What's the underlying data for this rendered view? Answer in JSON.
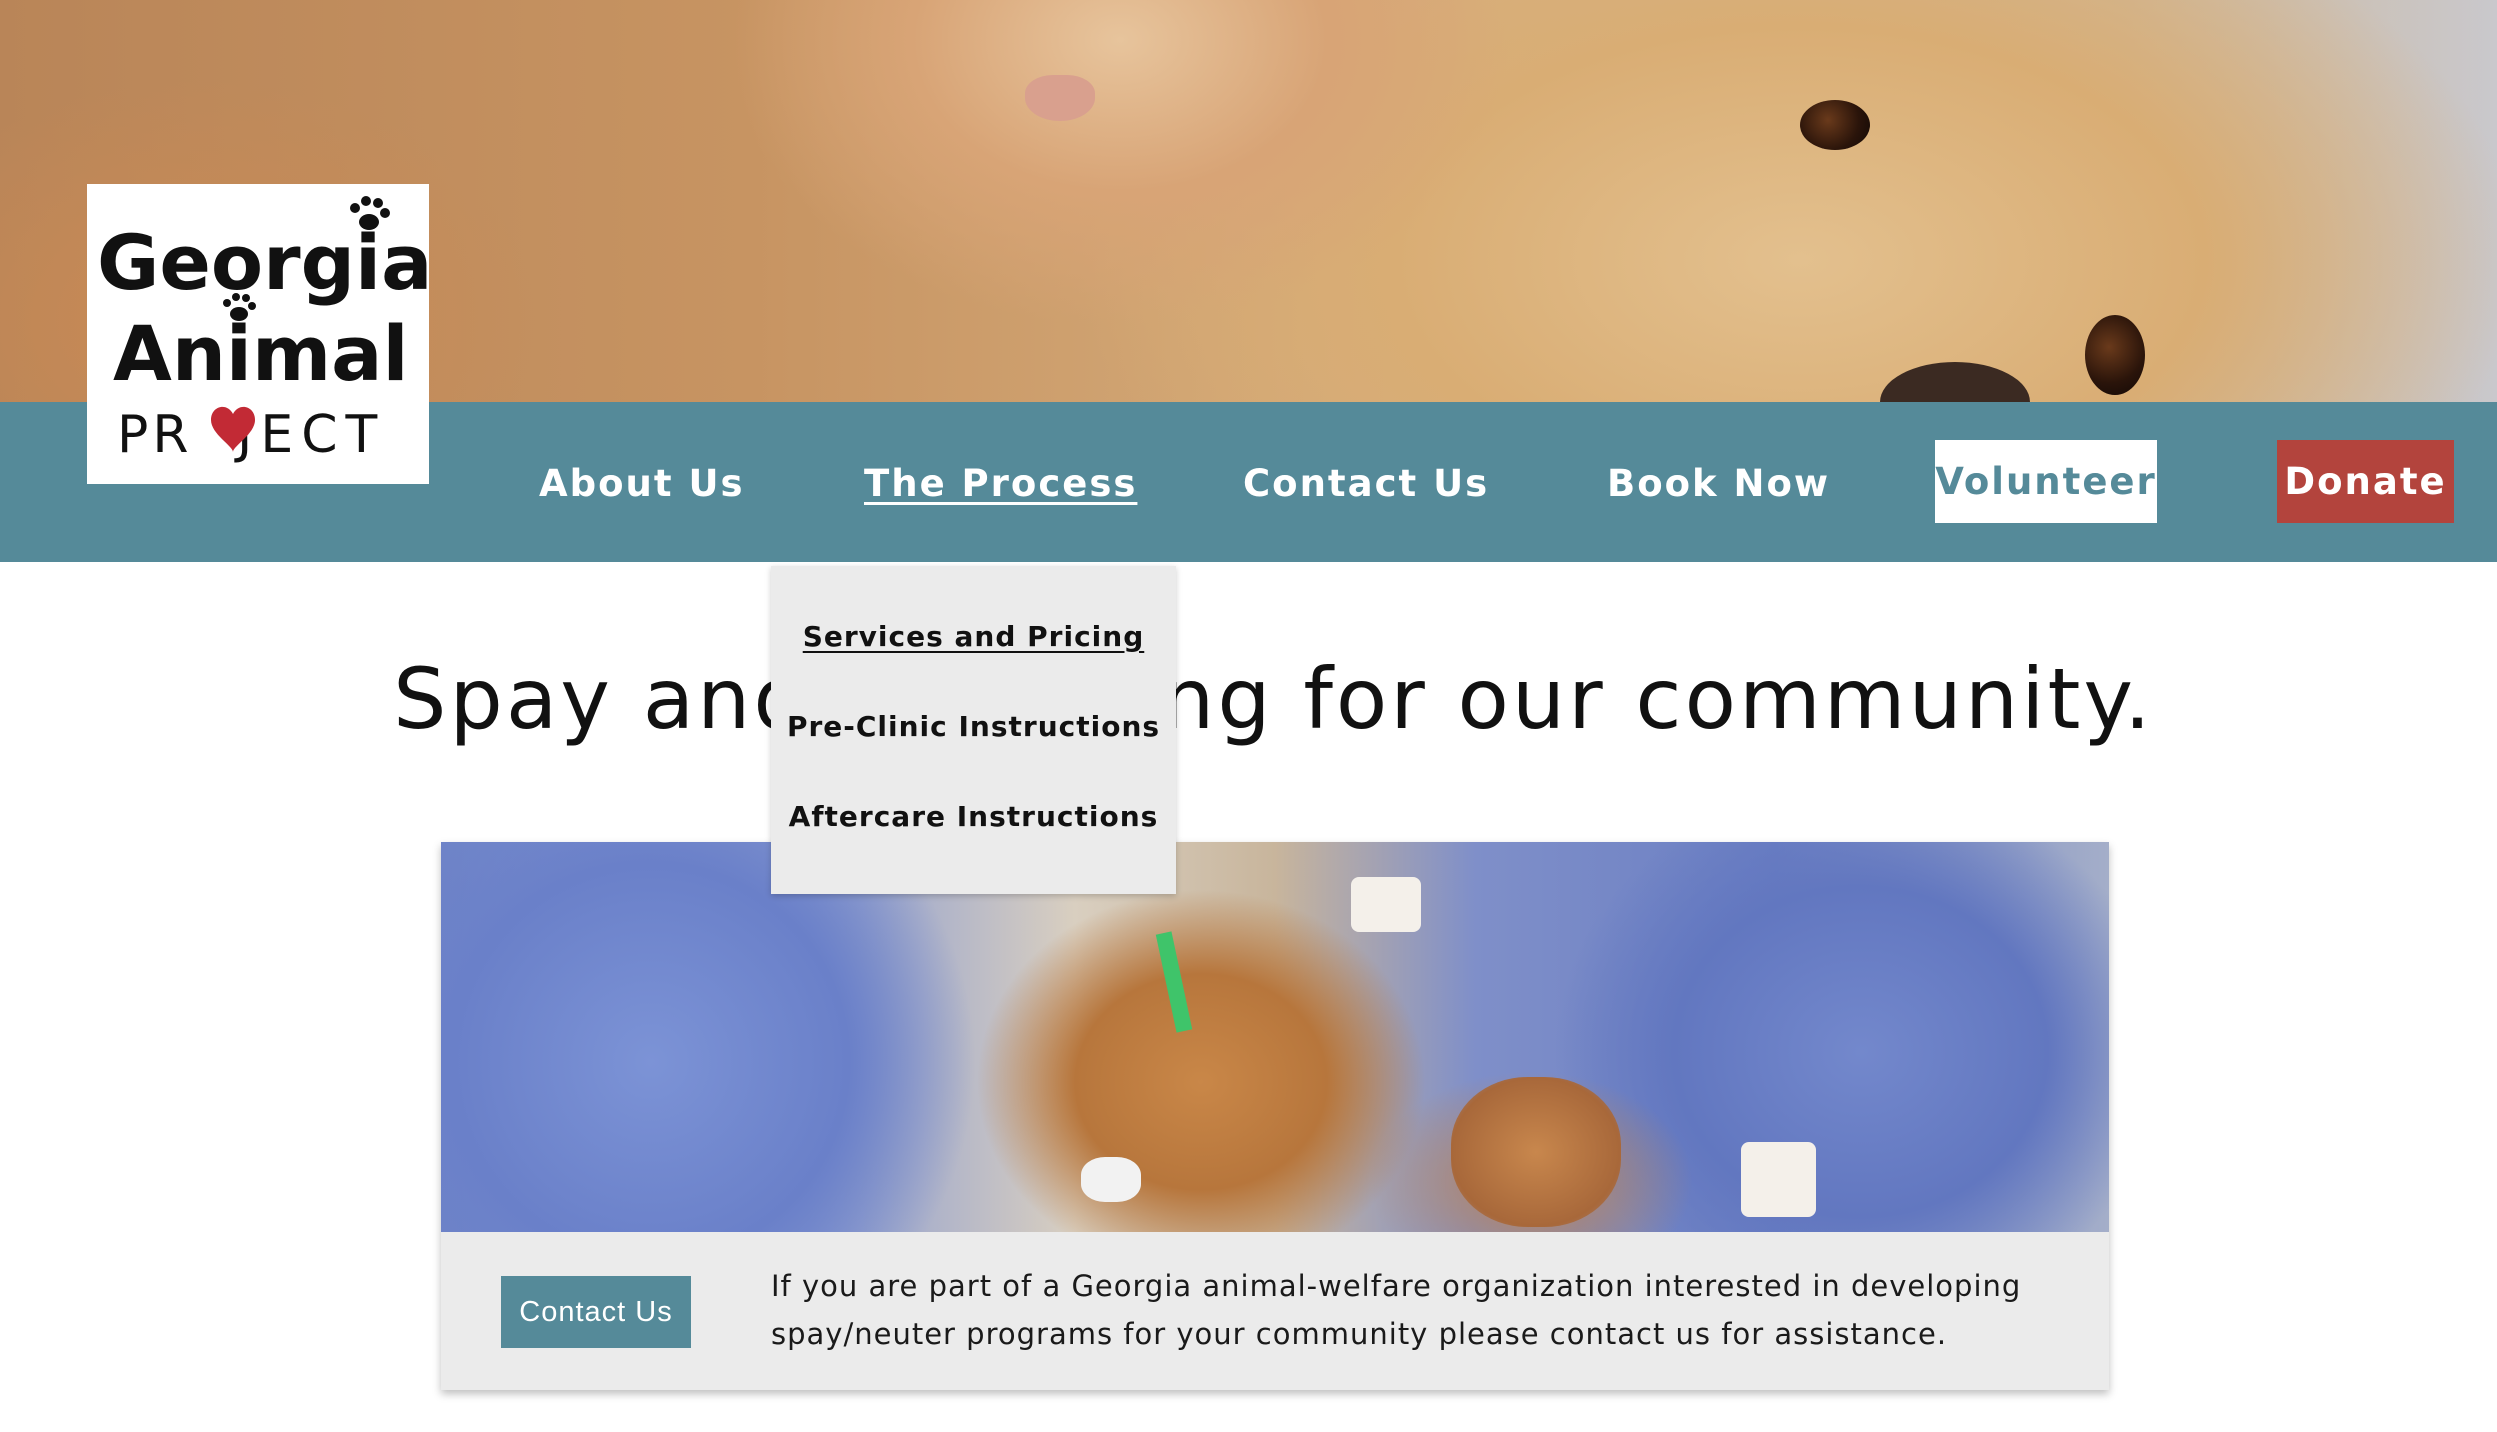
{
  "logo": {
    "line1": "Georgia",
    "line2": "Animal",
    "line3_left": "PR",
    "line3_right": "JECT"
  },
  "nav": {
    "items": [
      {
        "label": "About Us",
        "active": false
      },
      {
        "label": "The Process",
        "active": true
      },
      {
        "label": "Contact Us",
        "active": false
      },
      {
        "label": "Book Now",
        "active": false
      }
    ],
    "volunteer_label": "Volunteer",
    "donate_label": "Donate"
  },
  "dropdown": {
    "items": [
      {
        "label": "Services and Pricing",
        "active": true
      },
      {
        "label": "Pre-Clinic Instructions",
        "active": false
      },
      {
        "label": "Aftercare Instructions",
        "active": false
      }
    ]
  },
  "headline": "Spay and neutering for our community.",
  "card": {
    "button_label": "Contact Us",
    "text": "If you are part of a Georgia animal-welfare organization interested in developing spay/neuter programs for your community please contact us for assistance."
  },
  "colors": {
    "nav_bg": "#558a99",
    "donate_bg": "#b3443d",
    "card_bg": "#ebebeb",
    "heart": "#c22a35"
  }
}
